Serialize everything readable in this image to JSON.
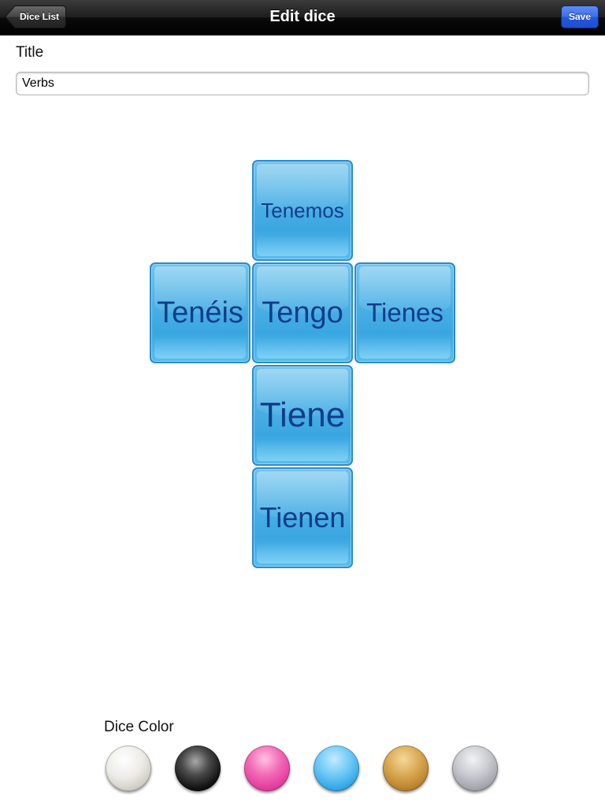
{
  "navbar": {
    "title": "Edit dice",
    "back_label": "Dice List",
    "save_label": "Save"
  },
  "form": {
    "title_label": "Title",
    "title_value": "Verbs"
  },
  "dice_faces": {
    "top": "Tenemos",
    "left": "Tenéis",
    "center": "Tengo",
    "right": "Tienes",
    "below": "Tiene",
    "bottom": "Tienen"
  },
  "color_picker": {
    "label": "Dice Color",
    "options": [
      "white",
      "black",
      "pink",
      "blue",
      "wood",
      "stone"
    ]
  },
  "colors": {
    "face_fill": "#4cb1e6",
    "face_text": "#0f3d8a",
    "save_button": "#2358df"
  }
}
